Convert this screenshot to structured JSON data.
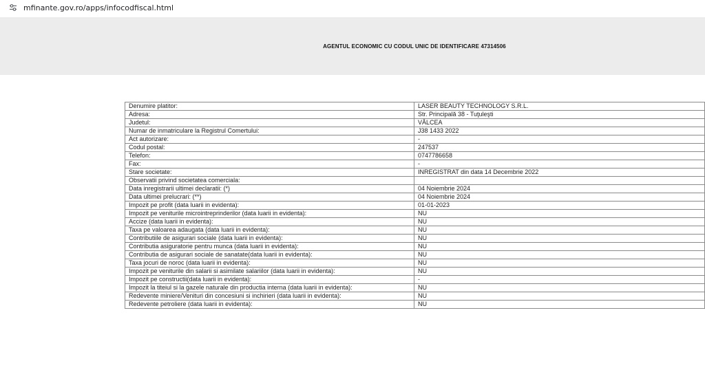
{
  "browser": {
    "url": "mfinante.gov.ro/apps/infocodfiscal.html",
    "site_icon": "tune-icon"
  },
  "banner": {
    "title": "AGENTUL ECONOMIC CU CODUL UNIC DE IDENTIFICARE 47314506"
  },
  "rows": [
    {
      "label": "Denumire platitor:",
      "value": "LASER BEAUTY TECHNOLOGY S.R.L."
    },
    {
      "label": "Adresa:",
      "value": "Str. Principală  38           - Tuţuleşti"
    },
    {
      "label": "Judetul:",
      "value": "VÂLCEA"
    },
    {
      "label": "Numar de inmatriculare la Registrul Comertului:",
      "value": "J38 1433 2022"
    },
    {
      "label": "Act autorizare:",
      "value": "-"
    },
    {
      "label": "Codul postal:",
      "value": "247537"
    },
    {
      "label": "Telefon:",
      "value": "0747786658"
    },
    {
      "label": "Fax:",
      "value": "-"
    },
    {
      "label": "Stare societate:",
      "value": "INREGISTRAT din data 14 Decembrie 2022"
    },
    {
      "label": "Observatii privind societatea comerciala:",
      "value": ""
    },
    {
      "label": "Data inregistrarii ultimei declaratii: (*)",
      "value": "04 Noiembrie 2024"
    },
    {
      "label": "Data ultimei prelucrari: (**)",
      "value": "04 Noiembrie 2024"
    },
    {
      "label": "Impozit pe profit (data luarii in evidenta):",
      "value": "01-01-2023"
    },
    {
      "label": "Impozit pe veniturile microintreprinderilor (data luarii in evidenta):",
      "value": "NU"
    },
    {
      "label": "Accize (data luarii in evidenta):",
      "value": "NU"
    },
    {
      "label": "Taxa pe valoarea adaugata (data luarii in evidenta):",
      "value": "NU"
    },
    {
      "label": "Contributiile de asigurari sociale (data luarii in evidenta):",
      "value": "NU"
    },
    {
      "label": "Contributia asiguratorie pentru munca (data luarii in evidenta):",
      "value": "NU"
    },
    {
      "label": "Contributia de asigurari sociale de sanatate(data luarii in evidenta):",
      "value": "NU"
    },
    {
      "label": "Taxa jocuri de noroc (data luarii in evidenta):",
      "value": "NU"
    },
    {
      "label": "Impozit pe veniturile din salarii si asimilate salariilor (data luarii in evidenta):",
      "value": "NU"
    },
    {
      "label": "Impozit pe constructii(data luarii in evidenta):",
      "value": "-"
    },
    {
      "label": "Impozit la titeiul si la gazele naturale din productia interna (data luarii in evidenta):",
      "value": "NU"
    },
    {
      "label": "Redevente miniere/Venituri din concesiuni si inchirieri (data luarii in evidenta):",
      "value": "NU"
    },
    {
      "label": "Redevente petroliere (data luarii in evidenta):",
      "value": "NU"
    }
  ]
}
